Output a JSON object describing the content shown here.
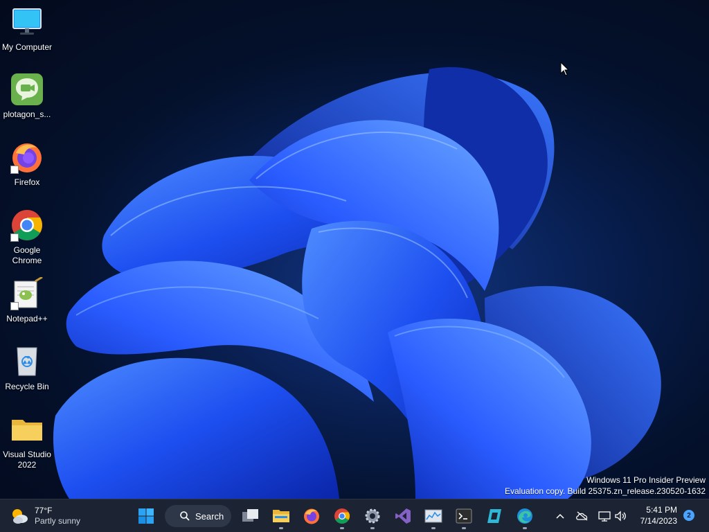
{
  "desktop_icons": [
    {
      "label": "My Computer",
      "icon": "monitor-icon"
    },
    {
      "label": "plotagon_s...",
      "icon": "plotagon-icon"
    },
    {
      "label": "Firefox",
      "icon": "firefox-icon"
    },
    {
      "label": "Google Chrome",
      "icon": "chrome-icon"
    },
    {
      "label": "Notepad++",
      "icon": "notepadpp-icon"
    },
    {
      "label": "Recycle Bin",
      "icon": "recycle-bin-icon"
    },
    {
      "label": "Visual Studio 2022",
      "icon": "folder-icon"
    }
  ],
  "watermark": {
    "line1": "Windows 11 Pro Insider Preview",
    "line2": "Evaluation copy. Build 25375.zn_release.230520-1632"
  },
  "taskbar": {
    "weather": {
      "temp": "77°F",
      "condition": "Partly sunny"
    },
    "search_label": "Search",
    "pinned": [
      "start-icon",
      "task-view-icon",
      "file-explorer-icon",
      "firefox-icon",
      "chrome-icon",
      "settings-icon",
      "visual-studio-icon",
      "resource-monitor-icon",
      "terminal-icon",
      "azure-data-studio-icon",
      "edge-icon"
    ],
    "clock": {
      "time": "5:41 PM",
      "date": "7/14/2023"
    },
    "notification_count": "2"
  },
  "colors": {
    "taskbar_bg": "#1c2433",
    "wallpaper_bloom": "#1f5cff",
    "desktop_bg": "#061a45"
  }
}
